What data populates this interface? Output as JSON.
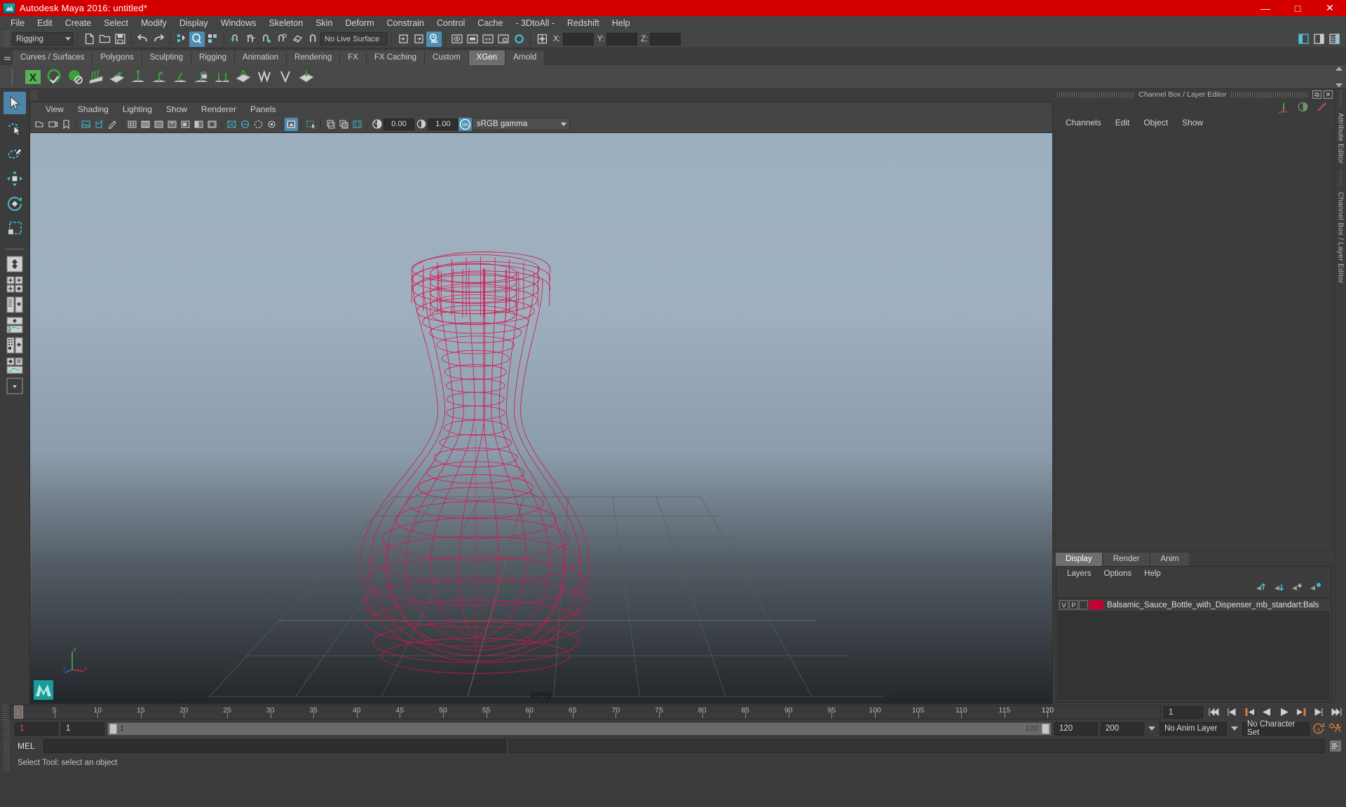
{
  "window": {
    "title": "Autodesk Maya 2016: untitled*",
    "app_icon": "maya-logo-icon",
    "buttons": {
      "minimize": "—",
      "maximize": "□",
      "close": "✕"
    },
    "titlebar_color": "#d40000"
  },
  "menubar": {
    "items": [
      "File",
      "Edit",
      "Create",
      "Select",
      "Modify",
      "Display",
      "Windows",
      "Skeleton",
      "Skin",
      "Deform",
      "Constrain",
      "Control",
      "Cache",
      "- 3DtoAll -",
      "Redshift",
      "Help"
    ]
  },
  "statusline": {
    "menu_set": "Rigging",
    "live_surface": "No Live Surface",
    "coord_labels": {
      "x": "X:",
      "y": "Y:",
      "z": "Z:"
    },
    "coord_values": {
      "x": "",
      "y": "",
      "z": ""
    }
  },
  "shelf": {
    "tabs": [
      "Curves / Surfaces",
      "Polygons",
      "Sculpting",
      "Rigging",
      "Animation",
      "Rendering",
      "FX",
      "FX Caching",
      "Custom",
      "XGen",
      "Arnold"
    ],
    "active_tab": "XGen"
  },
  "toolbox": {
    "items": [
      {
        "name": "select-tool",
        "selected": true
      },
      {
        "name": "lasso-select-tool",
        "selected": false
      },
      {
        "name": "paint-select-tool",
        "selected": false
      },
      {
        "name": "move-tool",
        "selected": false
      },
      {
        "name": "rotate-tool",
        "selected": false
      },
      {
        "name": "scale-tool",
        "selected": false
      },
      {
        "name": "last-tool-used",
        "selected": false
      }
    ],
    "layout_presets": [
      "single-perspective-view",
      "four-view",
      "outliner-persp",
      "persp-graph-editor",
      "hypershade-persp",
      "persp-outliner-graph",
      "layout-menu"
    ]
  },
  "viewport": {
    "menu": [
      "View",
      "Shading",
      "Lighting",
      "Show",
      "Renderer",
      "Panels"
    ],
    "exposure": "0.00",
    "gamma": "1.00",
    "color_management_toggle": "ON",
    "color_profile": "sRGB gamma",
    "camera_label": "persp",
    "axis": {
      "x": "x",
      "y": "y",
      "z": "z"
    },
    "model_color": "#d4174a"
  },
  "channelbox": {
    "panel_title": "Channel Box / Layer Editor",
    "menu": [
      "Channels",
      "Edit",
      "Object",
      "Show"
    ],
    "window_buttons": {
      "undock": "⧉",
      "close": "✕"
    }
  },
  "layer_editor": {
    "tabs": [
      "Display",
      "Render",
      "Anim"
    ],
    "active_tab": "Display",
    "menu": [
      "Layers",
      "Options",
      "Help"
    ],
    "layers": [
      {
        "visibility": "V",
        "playback": "P",
        "shading": "",
        "color": "#c80032",
        "name": "Balsamic_Sauce_Bottle_with_Dispenser_mb_standart:Bals"
      }
    ]
  },
  "side_tabs": {
    "attribute_editor": "Attribute Editor",
    "channel_box": "Channel Box / Layer Editor"
  },
  "timeslider": {
    "ticks": [
      5,
      10,
      15,
      20,
      25,
      30,
      35,
      40,
      45,
      50,
      55,
      60,
      65,
      70,
      75,
      80,
      85,
      90,
      95,
      100,
      105,
      110,
      115,
      120
    ],
    "current_frame": "1",
    "end_label": "120",
    "frame_field": "1",
    "playback_buttons": [
      "go-to-start",
      "step-back-frame",
      "step-back-key",
      "play-backwards",
      "play-forwards",
      "step-forward-key",
      "step-forward-frame",
      "go-to-end"
    ]
  },
  "rangeslider": {
    "anim_start": "1",
    "range_start": "1",
    "bar_min": "1",
    "bar_max": "120",
    "range_end": "120",
    "anim_end": "200",
    "anim_layer": "No Anim Layer",
    "character_set": "No Character Set",
    "auto_key_icon": "auto-keyframe-icon",
    "anim_prefs_icon": "animation-preferences-icon"
  },
  "commandline": {
    "language_label": "MEL",
    "input_value": "",
    "output_value": "",
    "script_editor_icon": "script-editor-icon"
  },
  "helpline": {
    "text": "Select Tool: select an object"
  }
}
